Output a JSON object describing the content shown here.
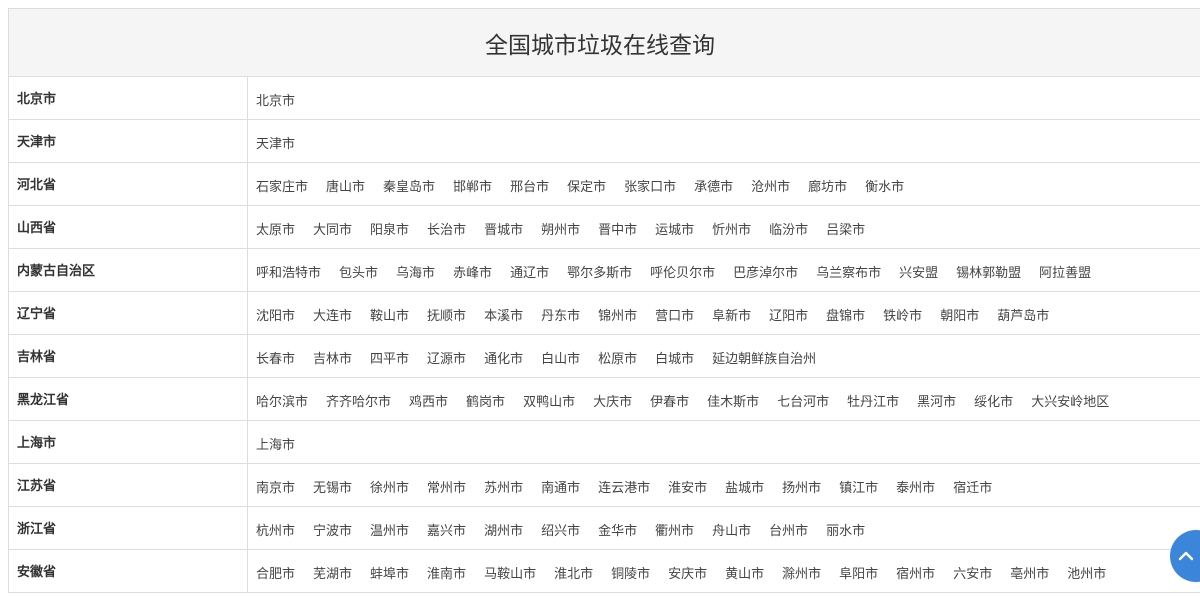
{
  "title": "全国城市垃圾在线查询",
  "provinces": [
    {
      "name": "北京市",
      "cities": [
        "北京市"
      ]
    },
    {
      "name": "天津市",
      "cities": [
        "天津市"
      ]
    },
    {
      "name": "河北省",
      "cities": [
        "石家庄市",
        "唐山市",
        "秦皇岛市",
        "邯郸市",
        "邢台市",
        "保定市",
        "张家口市",
        "承德市",
        "沧州市",
        "廊坊市",
        "衡水市"
      ]
    },
    {
      "name": "山西省",
      "cities": [
        "太原市",
        "大同市",
        "阳泉市",
        "长治市",
        "晋城市",
        "朔州市",
        "晋中市",
        "运城市",
        "忻州市",
        "临汾市",
        "吕梁市"
      ]
    },
    {
      "name": "内蒙古自治区",
      "cities": [
        "呼和浩特市",
        "包头市",
        "乌海市",
        "赤峰市",
        "通辽市",
        "鄂尔多斯市",
        "呼伦贝尔市",
        "巴彦淖尔市",
        "乌兰察布市",
        "兴安盟",
        "锡林郭勒盟",
        "阿拉善盟"
      ]
    },
    {
      "name": "辽宁省",
      "cities": [
        "沈阳市",
        "大连市",
        "鞍山市",
        "抚顺市",
        "本溪市",
        "丹东市",
        "锦州市",
        "营口市",
        "阜新市",
        "辽阳市",
        "盘锦市",
        "铁岭市",
        "朝阳市",
        "葫芦岛市"
      ]
    },
    {
      "name": "吉林省",
      "cities": [
        "长春市",
        "吉林市",
        "四平市",
        "辽源市",
        "通化市",
        "白山市",
        "松原市",
        "白城市",
        "延边朝鲜族自治州"
      ]
    },
    {
      "name": "黑龙江省",
      "cities": [
        "哈尔滨市",
        "齐齐哈尔市",
        "鸡西市",
        "鹤岗市",
        "双鸭山市",
        "大庆市",
        "伊春市",
        "佳木斯市",
        "七台河市",
        "牡丹江市",
        "黑河市",
        "绥化市",
        "大兴安岭地区"
      ]
    },
    {
      "name": "上海市",
      "cities": [
        "上海市"
      ]
    },
    {
      "name": "江苏省",
      "cities": [
        "南京市",
        "无锡市",
        "徐州市",
        "常州市",
        "苏州市",
        "南通市",
        "连云港市",
        "淮安市",
        "盐城市",
        "扬州市",
        "镇江市",
        "泰州市",
        "宿迁市"
      ]
    },
    {
      "name": "浙江省",
      "cities": [
        "杭州市",
        "宁波市",
        "温州市",
        "嘉兴市",
        "湖州市",
        "绍兴市",
        "金华市",
        "衢州市",
        "舟山市",
        "台州市",
        "丽水市"
      ]
    },
    {
      "name": "安徽省",
      "cities": [
        "合肥市",
        "芜湖市",
        "蚌埠市",
        "淮南市",
        "马鞍山市",
        "淮北市",
        "铜陵市",
        "安庆市",
        "黄山市",
        "滁州市",
        "阜阳市",
        "宿州市",
        "六安市",
        "亳州市",
        "池州市"
      ]
    }
  ],
  "back_to_top_icon": "chevron-up-icon",
  "colors": {
    "accent": "#3b86db",
    "header_bg": "#f5f5f5",
    "border": "#dddddd"
  }
}
